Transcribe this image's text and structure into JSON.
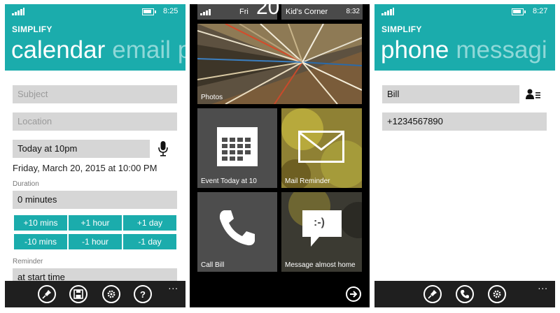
{
  "left_phone": {
    "status": {
      "time": "8:25"
    },
    "app_title": "SIMPLIFY",
    "pivot": {
      "active": "calendar",
      "next": "email",
      "peek": "p"
    },
    "subject_placeholder": "Subject",
    "location_placeholder": "Location",
    "when_value": "Today at 10pm",
    "parsed_datetime": "Friday, March 20, 2015 at 10:00 PM",
    "duration_label": "Duration",
    "duration_value": "0 minutes",
    "quick_buttons": [
      "+10 mins",
      "+1 hour",
      "+1 day",
      "-10 mins",
      "-1 hour",
      "-1 day"
    ],
    "reminder_label": "Reminder",
    "reminder_value": "at start time",
    "appbar_icons": [
      "pin-icon",
      "save-icon",
      "settings-icon",
      "help-icon"
    ],
    "more": "..."
  },
  "middle_phone": {
    "header": {
      "day": "Fri",
      "date": "20",
      "kids_corner": "Kid's Corner",
      "time": "8:32"
    },
    "tiles": {
      "photos": "Photos",
      "event": "Event Today at 10",
      "mail": "Mail Reminder",
      "call": "Call Bill",
      "message": "Message almost home"
    },
    "message_glyph": ":-)",
    "tile_colors": {
      "tile": "#4d4d4d",
      "photo_tile": "#8a6f3a"
    }
  },
  "right_phone": {
    "status": {
      "time": "8:27"
    },
    "app_title": "SIMPLIFY",
    "pivot": {
      "active": "phone",
      "next": "messagi"
    },
    "contact_value": "Bill",
    "number_value": "+1234567890",
    "appbar_icons": [
      "pin-icon",
      "phone-icon",
      "settings-icon"
    ],
    "more": "..."
  },
  "colors": {
    "accent": "#1bacac",
    "field": "#d6d6d6",
    "appbar": "#1f1f1f"
  }
}
